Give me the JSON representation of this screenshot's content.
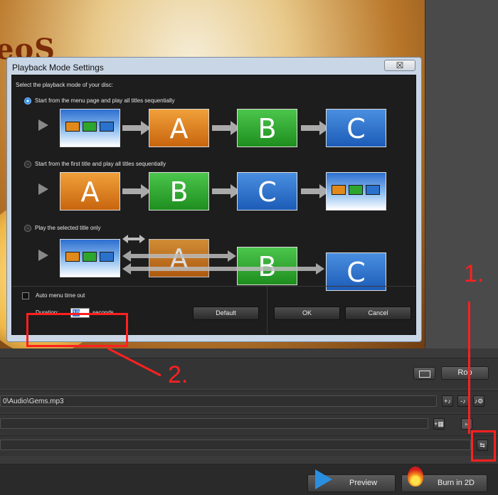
{
  "background": {
    "title_fragment": "eoS"
  },
  "dialog": {
    "title": "Playback Mode Settings",
    "close_glyph": "☒",
    "prompt": "Select the playback mode of your disc:",
    "options": [
      {
        "label": "Start from the menu page and play all titles sequentially",
        "selected": true
      },
      {
        "label": "Start from the first title and play all titles sequentially",
        "selected": false
      },
      {
        "label": "Play the selected title only",
        "selected": false
      }
    ],
    "tiles": {
      "a": "A",
      "b": "B",
      "c": "C",
      "mini_a": "A",
      "mini_b": "B",
      "mini_c": "C"
    },
    "auto_menu_label": "Auto menu time out",
    "duration_label": "Duration:",
    "duration_value": "19",
    "duration_unit": "seconds",
    "default_label": "Default",
    "ok_label": "OK",
    "cancel_label": "Cancel"
  },
  "lower": {
    "room_label": "Roo",
    "audio_path": "0\\Audio\\Gems.mp3",
    "preview_label": "Preview",
    "burn_label": "Burn in 2D"
  },
  "annotations": {
    "step1": "1.",
    "step2": "2."
  },
  "colors": {
    "accent_red": "#ff2020",
    "tile_a": "#e08a1e",
    "tile_b": "#2ea62e",
    "tile_c": "#2a72cc"
  }
}
